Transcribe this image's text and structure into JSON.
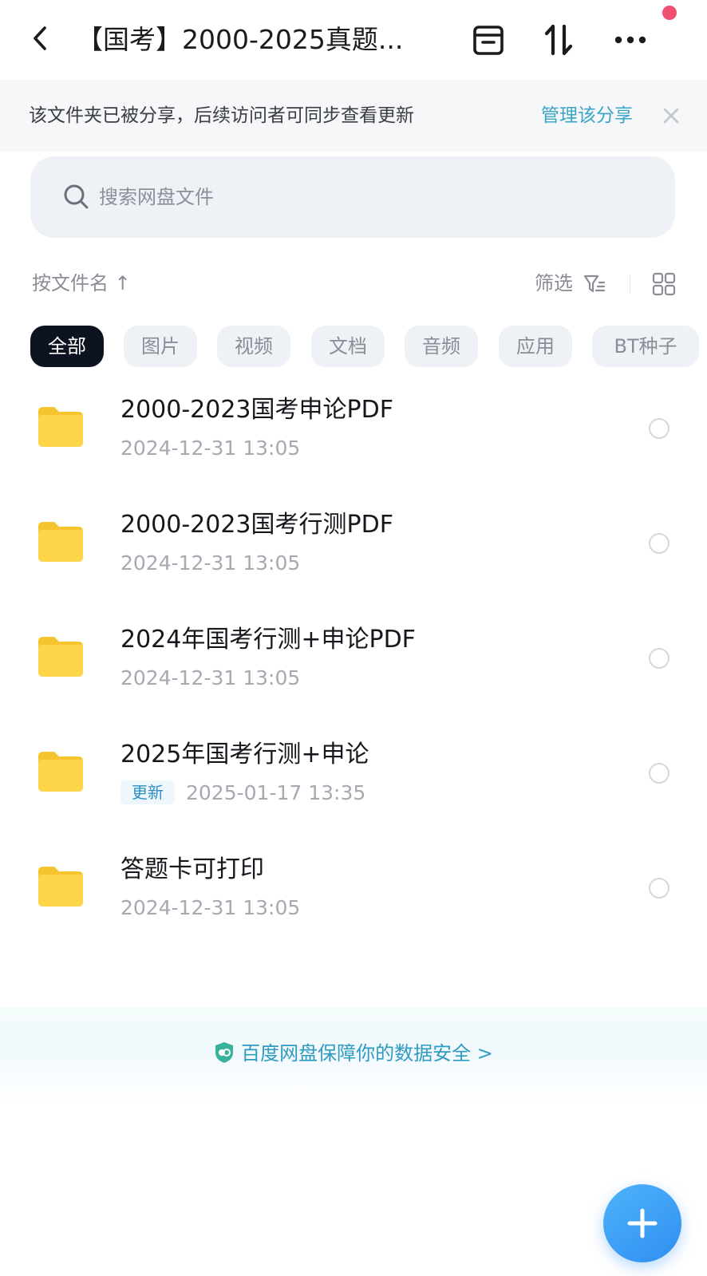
{
  "header": {
    "title": "【国考】2000-2025真题...",
    "back_icon": "chevron-left-icon",
    "actions": [
      "archive-icon",
      "transfer-icon",
      "more-icon"
    ]
  },
  "share_banner": {
    "text": "该文件夹已被分享，后续访问者可同步查看更新",
    "manage_label": "管理该分享",
    "close_icon": "close-icon"
  },
  "search": {
    "placeholder": "搜索网盘文件"
  },
  "sort_bar": {
    "sort_label": "按文件名 ↑",
    "filter_label": "筛选"
  },
  "categories": [
    {
      "label": "全部",
      "active": true
    },
    {
      "label": "图片"
    },
    {
      "label": "视频"
    },
    {
      "label": "文档"
    },
    {
      "label": "音频"
    },
    {
      "label": "应用"
    },
    {
      "label": "BT种子"
    }
  ],
  "files": [
    {
      "name": "2000-2023国考申论PDF",
      "badge": "",
      "date": "2024-12-31  13:05"
    },
    {
      "name": "2000-2023国考行测PDF",
      "badge": "",
      "date": "2024-12-31  13:05"
    },
    {
      "name": "2024年国考行测+申论PDF",
      "badge": "",
      "date": "2024-12-31  13:05"
    },
    {
      "name": "2025年国考行测+申论",
      "badge": "更新",
      "date": "2025-01-17  13:35"
    },
    {
      "name": "答题卡可打印",
      "badge": "",
      "date": "2024-12-31  13:05"
    }
  ],
  "security_banner": {
    "text": "百度网盘保障你的数据安全",
    "arrow": ">"
  },
  "colors": {
    "accent": "#3aa5c7",
    "active_chip": "#0d1320",
    "fab": "#3a9cf5",
    "folder": "#fcd34d",
    "notify_dot": "#f0506e"
  }
}
